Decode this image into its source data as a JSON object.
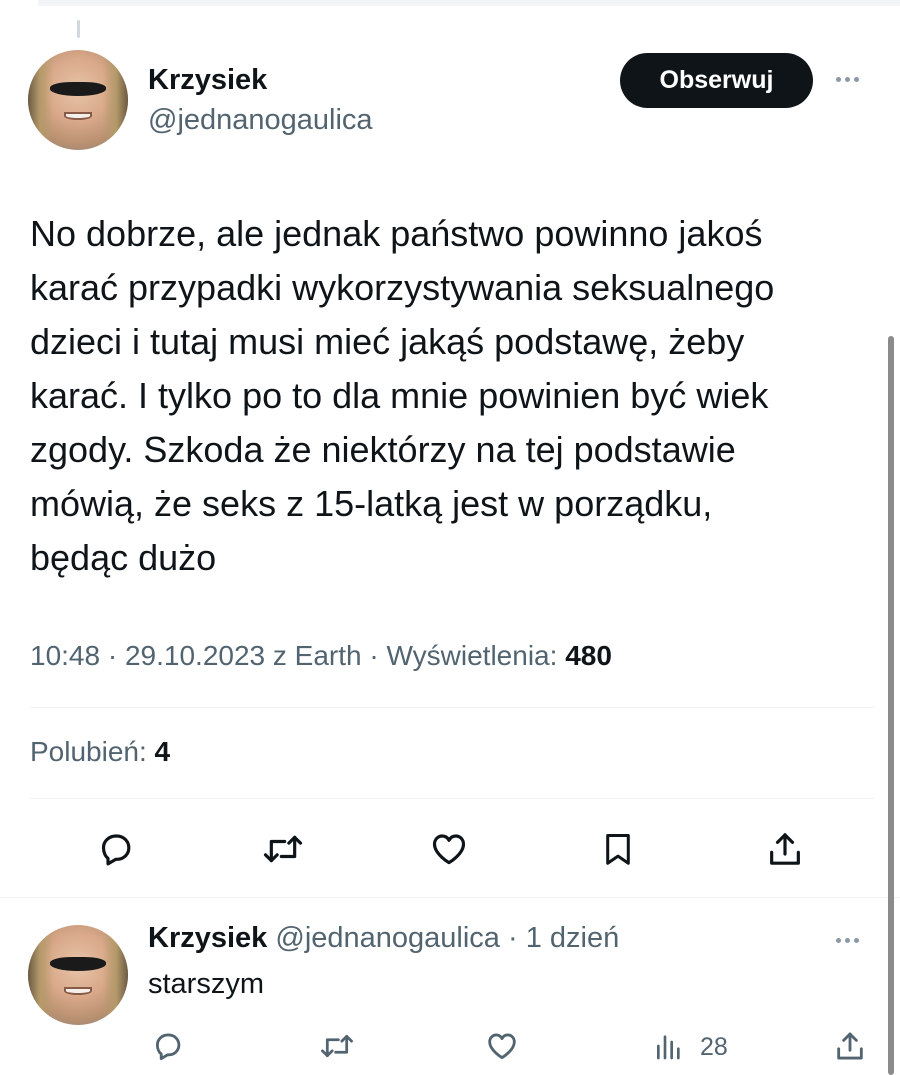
{
  "tweet": {
    "author": {
      "name": "Krzysiek",
      "handle": "@jednanogaulica"
    },
    "follow_label": "Obserwuj",
    "text": "No dobrze, ale jednak państwo powinno jakoś\nkarać przypadki wykorzystywania seksualnego\ndzieci i tutaj musi mieć jakąś podstawę, żeby\nkarać. I tylko po to dla mnie powinien być wiek\nzgody. Szkoda że niektórzy na tej podstawie\nmówią, że seks z 15-latką jest w porządku,\nbędąc dużo",
    "meta": {
      "time": "10:48",
      "sep1": " · ",
      "date": "29.10.2023",
      "source": " z Earth",
      "sep2": " · ",
      "views_label": "Wyświetlenia: ",
      "views_value": "480"
    },
    "likes": {
      "label": "Polubień: ",
      "value": "4"
    },
    "actions": [
      "reply-icon",
      "retweet-icon",
      "like-icon",
      "bookmark-icon",
      "share-icon"
    ]
  },
  "reply": {
    "author": {
      "name": "Krzysiek",
      "handle": "@jednanogaulica"
    },
    "separator": " · ",
    "time": "1 dzień",
    "text": "starszym",
    "views_count": "28",
    "actions": [
      "reply-icon",
      "retweet-icon",
      "like-icon",
      "views-icon",
      "share-icon"
    ]
  },
  "colors": {
    "text": "#0f1419",
    "muted": "#536471",
    "follow_bg": "#0f1419",
    "divider": "#eff3f4"
  }
}
